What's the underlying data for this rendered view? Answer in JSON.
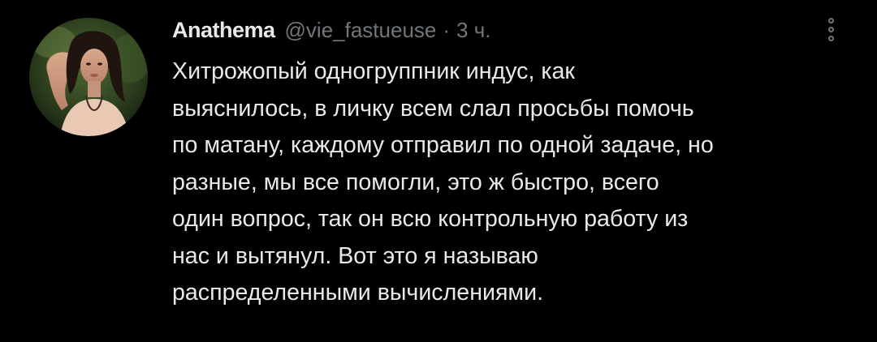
{
  "tweet": {
    "author": {
      "display_name": "Anathema",
      "handle": "@vie_fastueuse",
      "avatar": "profile-photo"
    },
    "separator": "·",
    "timestamp": "3 ч.",
    "more_icon": "more-vertical-icon",
    "text": "Хитрожопый одногруппник индус, как\nвыяснилось, в личку всем слал просьбы помочь\nпо матану, каждому отправил по одной задаче, но\nразные, мы все помогли, это ж быстро, всего\nодин вопрос, так он всю контрольную работу из\nнас и вытянул. Вот это я называю\nраспределенными вычислениями."
  },
  "colors": {
    "background": "#000000",
    "primary_text": "#e7e9ea",
    "secondary_text": "#71767b"
  }
}
